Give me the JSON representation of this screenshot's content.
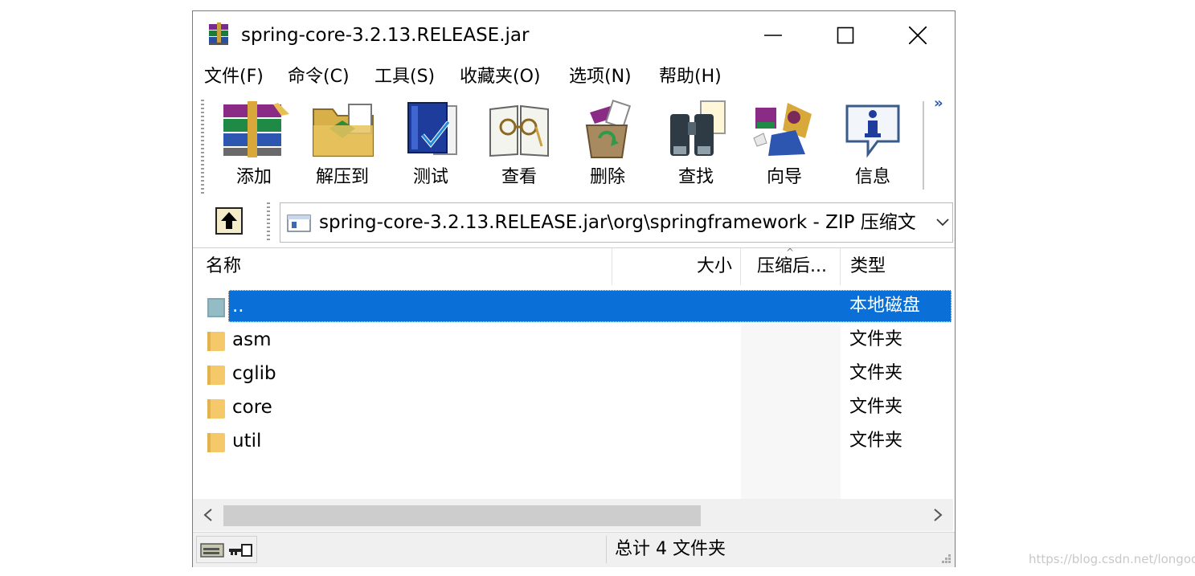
{
  "window": {
    "title": "spring-core-3.2.13.RELEASE.jar"
  },
  "menu": [
    "文件(F)",
    "命令(C)",
    "工具(S)",
    "收藏夹(O)",
    "选项(N)",
    "帮助(H)"
  ],
  "toolbar": [
    {
      "label": "添加",
      "icon": "add-archive-icon"
    },
    {
      "label": "解压到",
      "icon": "extract-to-icon"
    },
    {
      "label": "测试",
      "icon": "test-icon"
    },
    {
      "label": "查看",
      "icon": "view-icon"
    },
    {
      "label": "删除",
      "icon": "delete-icon"
    },
    {
      "label": "查找",
      "icon": "find-icon"
    },
    {
      "label": "向导",
      "icon": "wizard-icon"
    },
    {
      "label": "信息",
      "icon": "info-icon"
    }
  ],
  "toolbar_more": "»",
  "address": {
    "path": "spring-core-3.2.13.RELEASE.jar\\org\\springframework - ZIP 压缩文"
  },
  "columns": {
    "name": "名称",
    "size": "大小",
    "packed": "压缩后...",
    "type": "类型"
  },
  "files": [
    {
      "name": "..",
      "type": "本地磁盘",
      "selected": true
    },
    {
      "name": "asm",
      "type": "文件夹"
    },
    {
      "name": "cglib",
      "type": "文件夹"
    },
    {
      "name": "core",
      "type": "文件夹"
    },
    {
      "name": "util",
      "type": "文件夹"
    }
  ],
  "status": {
    "summary": "总计 4 文件夹"
  },
  "watermark": "https://blog.csdn.net/longool",
  "colors": {
    "selection": "#0a6fd6",
    "folder": "#f5c96a"
  }
}
